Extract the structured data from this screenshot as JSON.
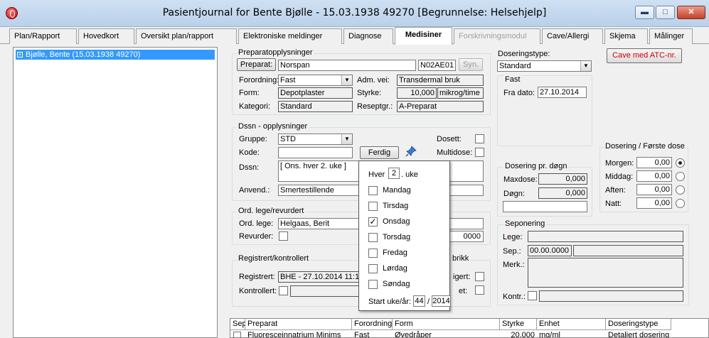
{
  "window": {
    "title": "Pasientjournal for Bente Bjølle - 15.03.1938 49270   [Begrunnelse: Helsehjelp]",
    "min_glyph": "▬",
    "max_glyph": "□",
    "close_glyph": "✕"
  },
  "tabs": [
    {
      "label": "Plan/Rapport"
    },
    {
      "label": "Hovedkort"
    },
    {
      "label": "Oversikt plan/rapport"
    },
    {
      "label": "Elektroniske meldinger"
    },
    {
      "label": "Diagnose"
    },
    {
      "label": "Medisiner",
      "active": true
    },
    {
      "label": "Forskrivningsmodul",
      "disabled": true
    },
    {
      "label": "Cave/Allergi"
    },
    {
      "label": "Skjema"
    },
    {
      "label": "Målinger"
    }
  ],
  "tree": {
    "patient": "Bjølle, Bente (15.03.1938 49270)",
    "expander": "+"
  },
  "preparat": {
    "group_label": "Preparatopplysninger",
    "button": "Preparat:",
    "name": "Norspan",
    "atc": "N02AE01",
    "syn_button": "Syn.",
    "forordning_label": "Forordning:",
    "forordning_value": "Fast",
    "adm_label": "Adm. vei:",
    "adm_value": "Transdermal bruk",
    "form_label": "Form:",
    "form_value": "Depotplaster",
    "styrke_label": "Styrke:",
    "styrke_value": "10,000",
    "styrke_unit": "mikrog/time",
    "kategori_label": "Kategori:",
    "kategori_value": "Standard",
    "reseptgr_label": "Reseptgr.:",
    "reseptgr_value": "A-Preparat"
  },
  "dssn": {
    "group_label": "Dssn - opplysninger",
    "gruppe_label": "Gruppe:",
    "gruppe_value": "STD",
    "kode_label": "Kode:",
    "kode_value": "",
    "ferdig_button": "Ferdig",
    "dosett_label": "Dosett:",
    "multidose_label": "Multidose:",
    "dssn_label": "Dssn:",
    "dssn_value": "[ Ons. hver 2. uke ]",
    "anvend_label": "Anvend.:",
    "anvend_value": "Smertestillende"
  },
  "ord": {
    "group_label": "Ord. lege/revurdert",
    "lege_label": "Ord. lege:",
    "lege_value": "Helgaas, Berit",
    "revurder_label": "Revurder:",
    "date_tail": "0000"
  },
  "registrert": {
    "group_label": "Registrert/kontrollert",
    "group_tail": "brikk",
    "registrert_label": "Registrert:",
    "registrert_value": "BHE - 27.10.2014 11:15",
    "kontrollert_label": "Kontrollert:",
    "right1": "igert:",
    "right2": "et:"
  },
  "popup": {
    "hver_label": "Hver",
    "hver_value": "2",
    "uke_label": ". uke",
    "days": [
      {
        "label": "Mandag",
        "checked": false
      },
      {
        "label": "Tirsdag",
        "checked": false
      },
      {
        "label": "Onsdag",
        "checked": true
      },
      {
        "label": "Torsdag",
        "checked": false
      },
      {
        "label": "Fredag",
        "checked": false
      },
      {
        "label": "Lørdag",
        "checked": false
      },
      {
        "label": "Søndag",
        "checked": false
      }
    ],
    "start_label": "Start uke/år:",
    "start_week": "44",
    "slash": "/",
    "start_year": "2014"
  },
  "doseringstype": {
    "label": "Doseringstype:",
    "value": "Standard",
    "fast_group": "Fast",
    "fra_dato_label": "Fra dato:",
    "fra_dato_value": "27.10.2014"
  },
  "cave_button": "Cave med ATC-nr.",
  "dosering_dogn": {
    "group_label": "Dosering pr. døgn",
    "maxdose_label": "Maxdose:",
    "maxdose_value": "0,000",
    "dogn_label": "Døgn:",
    "dogn_value": "0,000"
  },
  "forste_dose": {
    "group_label": "Dosering / Første dose",
    "rows": [
      {
        "label": "Morgen:",
        "value": "0,00",
        "selected": true
      },
      {
        "label": "Middag:",
        "value": "0,00",
        "selected": false
      },
      {
        "label": "Aften:",
        "value": "0,00",
        "selected": false
      },
      {
        "label": "Natt:",
        "value": "0,00",
        "selected": false
      }
    ]
  },
  "seponering": {
    "group_label": "Seponering",
    "lege_label": "Lege:",
    "sep_label": "Sep.:",
    "sep_value": "00.00.0000",
    "merk_label": "Merk.:",
    "kontr_label": "Kontr.:"
  },
  "table": {
    "headers": [
      "Sep",
      "Preparat",
      "Forordning",
      "Form",
      "Styrke",
      "Enhet",
      "Doseringstype"
    ],
    "row": [
      "",
      "Fluoresceinnatrium Minims",
      "Fast",
      "Øyedråper",
      "20,000",
      "mg/ml",
      "Detaljert dosering"
    ]
  }
}
